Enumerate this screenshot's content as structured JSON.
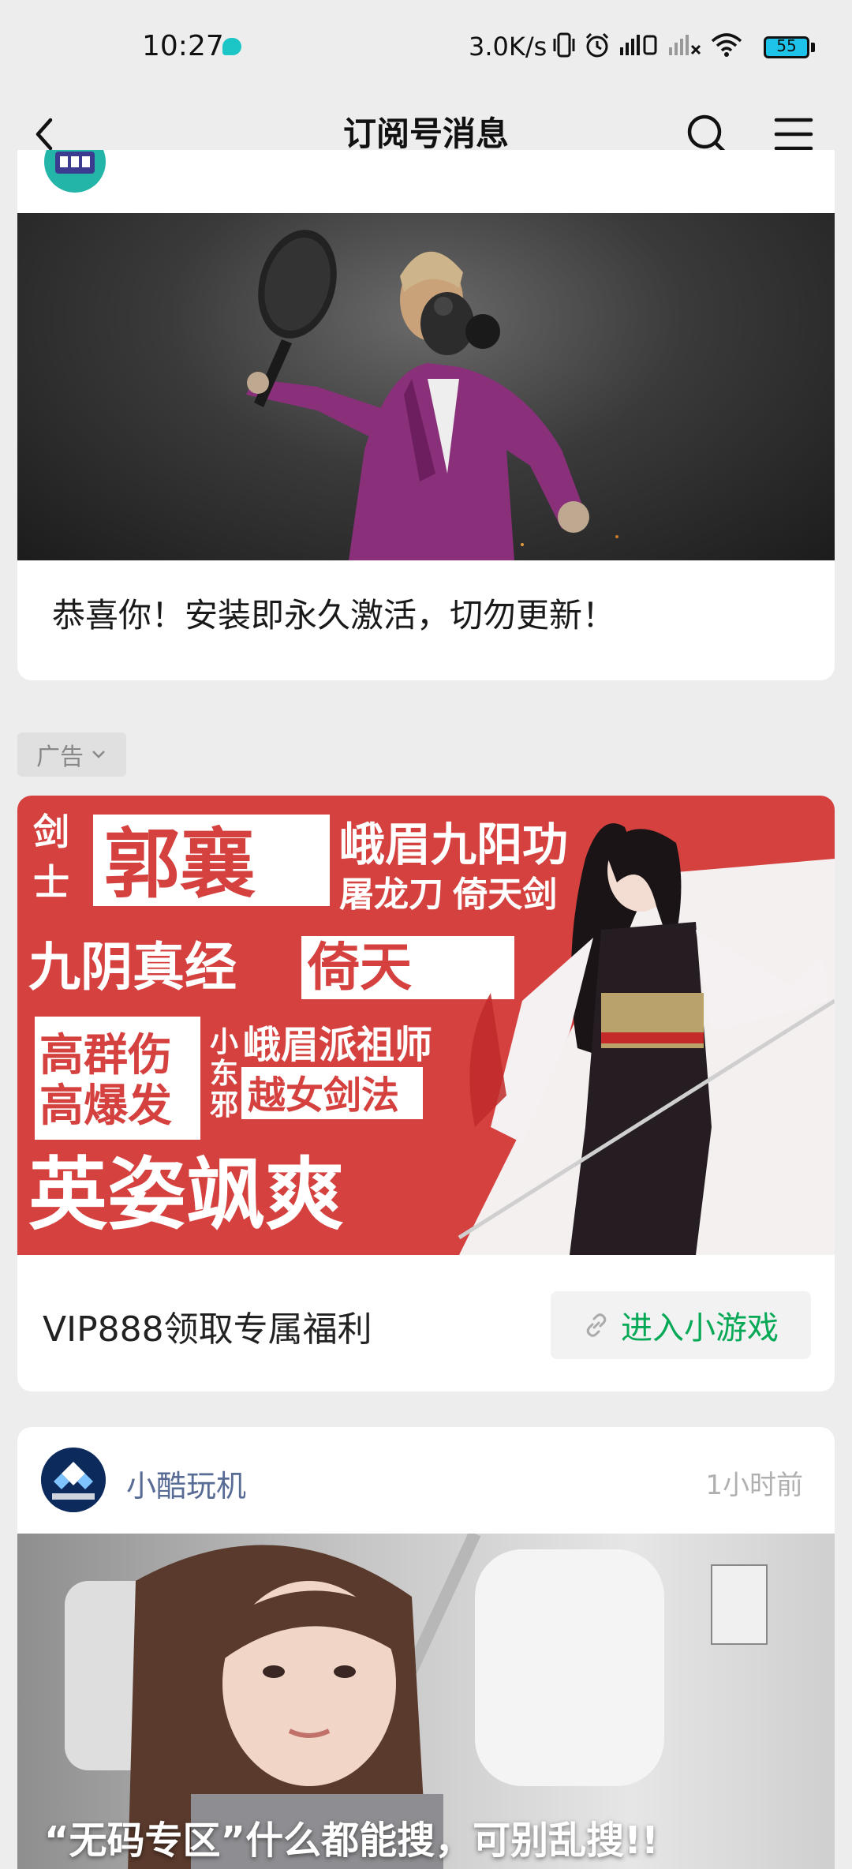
{
  "status_bar": {
    "time": "10:27",
    "net_speed": "3.0K/s",
    "battery": "55",
    "colors": {
      "bubble": "#1cc6c6",
      "battery": "#1ec3ea"
    }
  },
  "nav": {
    "title": "订阅号消息",
    "icons": [
      "back-arrow-icon",
      "search-icon",
      "menu-icon"
    ]
  },
  "card1": {
    "title": "恭喜你！安装即永久激活，切勿更新！"
  },
  "ad": {
    "label": "广告",
    "banner_text": {
      "col1": "剑\n士",
      "name": "郭襄",
      "line1": "峨眉九阳功",
      "line2": "屠龙刀 倚天剑",
      "line3a": "九阴真经",
      "line3b": "倚天",
      "line4a": "高群伤",
      "line4b": "高爆发",
      "small": "小\n东\n邪",
      "line4c": "峨眉派祖师",
      "line4d": "越女剑法",
      "big": "英姿飒爽"
    },
    "title": "VIP888领取专属福利",
    "button_label": "进入小游戏",
    "colors": {
      "banner_bg": "#d5413f",
      "button_text": "#07a957"
    }
  },
  "card3": {
    "account_name": "小酷玩机",
    "time": "1小时前",
    "caption": "“无码专区”什么都能搜，可别乱搜!!"
  }
}
